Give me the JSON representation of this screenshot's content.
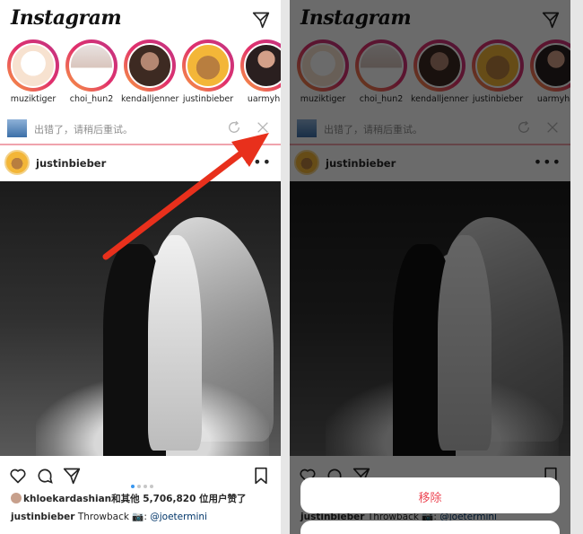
{
  "feed": {
    "logo": "Instagram",
    "stories": [
      {
        "name": "muziktiger"
      },
      {
        "name": "choi_hun2"
      },
      {
        "name": "kendalljenner"
      },
      {
        "name": "justinbieber"
      },
      {
        "name": "uarmyho"
      }
    ],
    "error": {
      "text": "出错了，请稍后重试。"
    },
    "post": {
      "username": "justinbieber",
      "likes_user": "khloekardashian",
      "likes_text": "和其他 5,706,820 位用户赞了",
      "caption_user": "justinbieber",
      "caption_text": "Throwback 📷: ",
      "caption_mention": "@joetermini"
    }
  },
  "sheet": {
    "remove_label": "移除"
  },
  "colors": {
    "accent": "#3897f0",
    "danger": "#ed4956",
    "arrow": "#e8301c",
    "error_underline": "#f0a3ad"
  }
}
